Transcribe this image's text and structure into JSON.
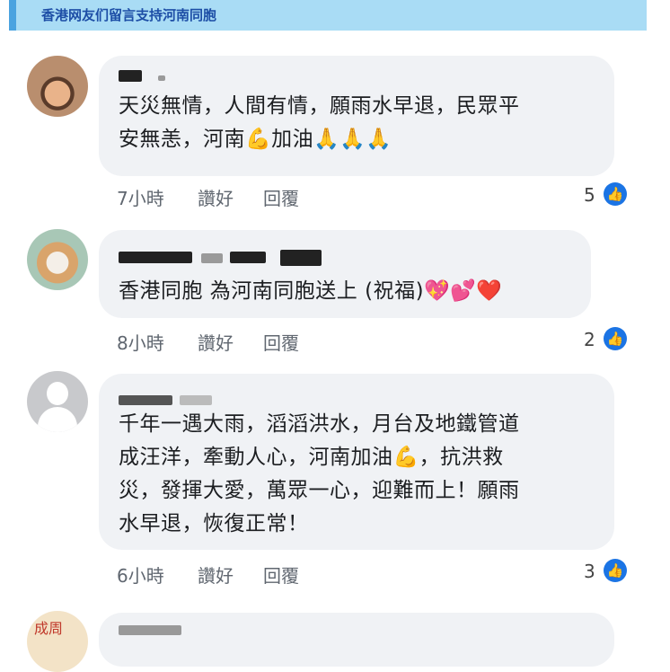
{
  "header": {
    "title": "香港网友们留言支持河南同胞"
  },
  "comments": [
    {
      "text": "天災無情，人間有情，願雨水早退，民眾平\n安無恙，河南💪加油🙏🙏🙏",
      "time": "7小時",
      "like_label": "讚好",
      "reply_label": "回覆",
      "like_count": "5"
    },
    {
      "text": "香港同胞 為河南同胞送上 (祝福)💖💕❤️",
      "time": "8小時",
      "like_label": "讚好",
      "reply_label": "回覆",
      "like_count": "2"
    },
    {
      "text": "千年一遇大雨，滔滔洪水，月台及地鐵管道\n成汪洋，牽動人心，河南加油💪，抗洪救\n災，發揮大愛，萬眾一心，迎難而上！願雨\n水早退，恢復正常！",
      "time": "6小時",
      "like_label": "讚好",
      "reply_label": "回覆",
      "like_count": "3"
    }
  ],
  "partial_avatar_text": "成周",
  "icons": {
    "like": "thumbs-up-icon"
  },
  "colors": {
    "like_blue": "#1b74e4",
    "header_bg": "#a9dcf5",
    "header_text": "#1d4ea6"
  }
}
